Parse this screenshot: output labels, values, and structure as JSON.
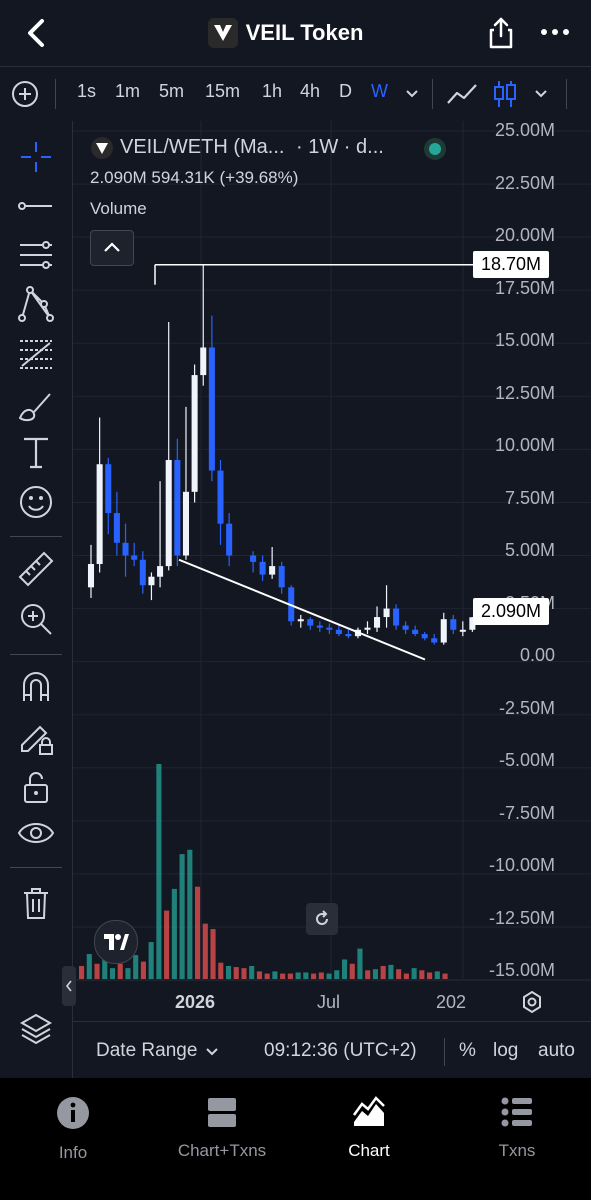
{
  "header": {
    "title": "VEIL Token"
  },
  "timeframes": {
    "items": [
      "1s",
      "1m",
      "5m",
      "15m",
      "1h",
      "4h",
      "D",
      "W"
    ],
    "selected": "W"
  },
  "legend": {
    "symbol": "VEIL/WETH (Ma...",
    "interval": "· 1W · d...",
    "stats": "2.090M 594.31K (+39.68%)",
    "volume_label": "Volume"
  },
  "colors": {
    "bullish": "#f0f3fa",
    "bearish": "#2962ff",
    "volume_up": "#26a69a",
    "volume_down": "#ef5350",
    "status_dot": "#26a69a"
  },
  "price_axis": {
    "labels": [
      "25.00M",
      "22.50M",
      "20.00M",
      "17.50M",
      "15.00M",
      "12.50M",
      "10.00M",
      "7.50M",
      "5.00M",
      "2.50M",
      "0.00",
      "-2.50M",
      "-5.00M",
      "-7.50M",
      "-10.00M",
      "-12.50M",
      "-15.00M"
    ],
    "high_marker": "18.70M",
    "last_price": "2.090M"
  },
  "time_axis": {
    "labels": [
      "2026",
      "Jul",
      "202"
    ]
  },
  "chart_data": {
    "type": "candlestick",
    "title": "",
    "series": [
      {
        "name": "VEIL/WETH",
        "unit": "M",
        "candles": [
          {
            "o": 3.5,
            "h": 5.5,
            "l": 3.0,
            "c": 4.6
          },
          {
            "o": 4.6,
            "h": 11.5,
            "l": 4.2,
            "c": 9.3
          },
          {
            "o": 9.3,
            "h": 9.6,
            "l": 6.0,
            "c": 7.0
          },
          {
            "o": 7.0,
            "h": 8.0,
            "l": 5.0,
            "c": 5.6
          },
          {
            "o": 5.6,
            "h": 6.5,
            "l": 4.0,
            "c": 5.0
          },
          {
            "o": 5.0,
            "h": 5.6,
            "l": 4.5,
            "c": 4.8
          },
          {
            "o": 4.8,
            "h": 5.2,
            "l": 3.2,
            "c": 3.6
          },
          {
            "o": 3.6,
            "h": 4.2,
            "l": 2.9,
            "c": 4.0
          },
          {
            "o": 4.0,
            "h": 8.5,
            "l": 3.5,
            "c": 4.5
          },
          {
            "o": 4.5,
            "h": 16.0,
            "l": 4.3,
            "c": 9.5
          },
          {
            "o": 9.5,
            "h": 10.5,
            "l": 4.5,
            "c": 5.0
          },
          {
            "o": 5.0,
            "h": 12.0,
            "l": 4.8,
            "c": 8.0
          },
          {
            "o": 8.0,
            "h": 14.0,
            "l": 7.5,
            "c": 13.5
          },
          {
            "o": 13.5,
            "h": 18.7,
            "l": 13.0,
            "c": 14.8
          },
          {
            "o": 14.8,
            "h": 16.3,
            "l": 8.5,
            "c": 9.0
          },
          {
            "o": 9.0,
            "h": 9.5,
            "l": 5.5,
            "c": 6.5
          },
          {
            "o": 6.5,
            "h": 7.0,
            "l": 4.5,
            "c": 5.0
          },
          {
            "o": 5.0,
            "h": 5.2,
            "l": 4.2,
            "c": 4.7
          },
          {
            "o": 4.7,
            "h": 5.0,
            "l": 3.8,
            "c": 4.1
          },
          {
            "o": 4.1,
            "h": 5.4,
            "l": 3.9,
            "c": 4.5
          },
          {
            "o": 4.5,
            "h": 4.7,
            "l": 3.2,
            "c": 3.5
          },
          {
            "o": 3.5,
            "h": 3.6,
            "l": 1.7,
            "c": 1.9
          },
          {
            "o": 1.9,
            "h": 2.2,
            "l": 1.6,
            "c": 2.0
          },
          {
            "o": 2.0,
            "h": 2.1,
            "l": 1.5,
            "c": 1.7
          },
          {
            "o": 1.7,
            "h": 1.9,
            "l": 1.4,
            "c": 1.6
          },
          {
            "o": 1.6,
            "h": 1.8,
            "l": 1.3,
            "c": 1.5
          },
          {
            "o": 1.5,
            "h": 1.7,
            "l": 1.2,
            "c": 1.3
          },
          {
            "o": 1.3,
            "h": 1.5,
            "l": 1.1,
            "c": 1.2
          },
          {
            "o": 1.2,
            "h": 1.6,
            "l": 1.1,
            "c": 1.5
          },
          {
            "o": 1.5,
            "h": 1.9,
            "l": 1.3,
            "c": 1.6
          },
          {
            "o": 1.6,
            "h": 2.6,
            "l": 1.4,
            "c": 2.1
          },
          {
            "o": 2.1,
            "h": 3.6,
            "l": 1.6,
            "c": 2.5
          },
          {
            "o": 2.5,
            "h": 2.7,
            "l": 1.5,
            "c": 1.7
          },
          {
            "o": 1.7,
            "h": 1.9,
            "l": 1.3,
            "c": 1.5
          },
          {
            "o": 1.5,
            "h": 1.7,
            "l": 1.2,
            "c": 1.3
          },
          {
            "o": 1.3,
            "h": 1.4,
            "l": 1.0,
            "c": 1.1
          },
          {
            "o": 1.1,
            "h": 1.3,
            "l": 0.8,
            "c": 0.9
          },
          {
            "o": 0.9,
            "h": 2.3,
            "l": 0.8,
            "c": 2.0
          },
          {
            "o": 2.0,
            "h": 2.2,
            "l": 1.3,
            "c": 1.5
          },
          {
            "o": 1.5,
            "h": 1.9,
            "l": 1.2,
            "c": 1.5
          },
          {
            "o": 1.5,
            "h": 2.1,
            "l": 1.4,
            "c": 2.09
          }
        ]
      }
    ],
    "volume": [
      1.2,
      2.3,
      1.4,
      1.8,
      1.0,
      1.4,
      1.0,
      2.2,
      1.6,
      3.4,
      19.8,
      6.3,
      8.3,
      11.5,
      11.9,
      8.5,
      5.1,
      4.6,
      1.5,
      1.2,
      1.1,
      1.0,
      1.2,
      0.7,
      0.5,
      0.7,
      0.5,
      0.5,
      0.6,
      0.6,
      0.5,
      0.6,
      0.5,
      0.8,
      1.8,
      1.4,
      2.8,
      0.8,
      0.9,
      1.2,
      1.3,
      0.9,
      0.5,
      1.0,
      0.8,
      0.6,
      0.7,
      0.5
    ],
    "volume_up": [
      false,
      true,
      false,
      true,
      true,
      false,
      true,
      true,
      false,
      true,
      true,
      false,
      true,
      true,
      true,
      false,
      false,
      false,
      false,
      true,
      false,
      false,
      true,
      false,
      false,
      true,
      false,
      false,
      true,
      true,
      false,
      false,
      true,
      true,
      true,
      false,
      true,
      false,
      true,
      false,
      true,
      false,
      false,
      true,
      false,
      false,
      true,
      false
    ],
    "ylim": [
      -15.0,
      25.0
    ],
    "xlabel": "",
    "ylabel": "",
    "x_tick_labels": [
      "2026",
      "Jul",
      "202"
    ],
    "grid": true,
    "trendline": true,
    "high_value": 18.7,
    "last_value": 2.09
  },
  "bottom_strip": {
    "date_range": "Date Range",
    "time": "09:12:36 (UTC+2)",
    "percent": "%",
    "log": "log",
    "auto": "auto"
  },
  "tabs": [
    {
      "label": "Info",
      "icon": "info-icon"
    },
    {
      "label": "Chart+Txns",
      "icon": "split-view-icon"
    },
    {
      "label": "Chart",
      "icon": "chart-icon",
      "active": true
    },
    {
      "label": "Txns",
      "icon": "list-icon"
    }
  ]
}
